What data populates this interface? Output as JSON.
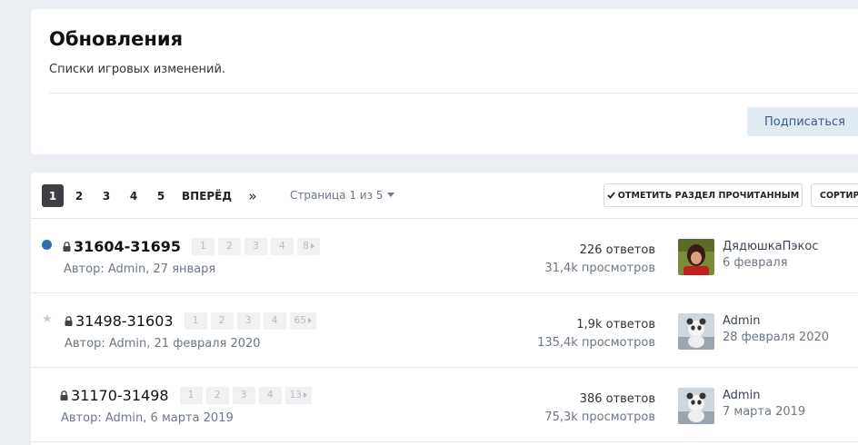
{
  "header": {
    "title": "Обновления",
    "description": "Списки игровых изменений.",
    "subscribe_label": "Подписаться"
  },
  "pagination": {
    "pages": [
      "1",
      "2",
      "3",
      "4",
      "5"
    ],
    "active": "1",
    "next_label": "ВПЕРЁД",
    "last_label": "»",
    "page_info": "Страница 1 из 5",
    "mark_read_label": "ОТМЕТИТЬ РАЗДЕЛ ПРОЧИТАННЫМ",
    "sort_label": "СОРТИР"
  },
  "threads": [
    {
      "title": "31604-31695",
      "unread": true,
      "status_icon": "unread-dot",
      "locked": true,
      "mini_pages": [
        "1",
        "2",
        "3",
        "4",
        "8"
      ],
      "meta": "Автор: Admin, 27 января",
      "replies": "226 ответов",
      "views": "31,4k просмотров",
      "last_user": "ДядюшкаПэкос",
      "last_date": "6 февраля",
      "avatar": "user-avatar-photo"
    },
    {
      "title": "31498-31603",
      "unread": false,
      "status_icon": "star-icon",
      "locked": true,
      "mini_pages": [
        "1",
        "2",
        "3",
        "4",
        "65"
      ],
      "meta": "Автор: Admin, 21 февраля 2020",
      "replies": "1,9k ответов",
      "views": "135,4k просмотров",
      "last_user": "Admin",
      "last_date": "28 февраля 2020",
      "avatar": "admin-avatar"
    },
    {
      "title": "31170-31498",
      "unread": false,
      "status_icon": "",
      "locked": true,
      "mini_pages": [
        "1",
        "2",
        "3",
        "4",
        "13"
      ],
      "meta": "Автор: Admin, 6 марта 2019",
      "replies": "386 ответов",
      "views": "75,3k просмотров",
      "last_user": "Admin",
      "last_date": "7 марта 2019",
      "avatar": "admin-avatar"
    }
  ],
  "colors": {
    "accent": "#2f6db3",
    "page_active_bg": "#3d3f45",
    "subscribe_bg": "#e1e9f3",
    "page_bg": "#ebeef3"
  }
}
